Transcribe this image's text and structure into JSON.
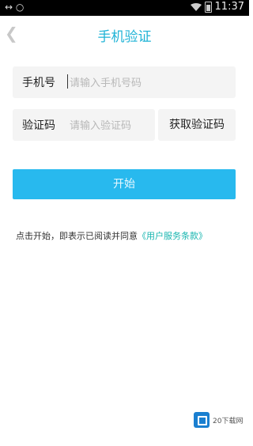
{
  "status_bar": {
    "left_icons": "↔ ○",
    "time": "11:37"
  },
  "header": {
    "back_icon": "chevron-left-icon",
    "title": "手机验证"
  },
  "form": {
    "phone_label": "手机号",
    "phone_placeholder": "请输入手机号码",
    "code_label": "验证码",
    "code_placeholder": "请输入验证码",
    "get_code_label": "获取验证码",
    "start_label": "开始"
  },
  "agreement": {
    "prefix": "点击开始，即表示已阅读并同意",
    "link": "《用户服务条款》"
  },
  "watermark": {
    "text": "20下载网"
  },
  "colors": {
    "accent": "#28b9ee",
    "title": "#1fb3d6",
    "link": "#19b6b0"
  }
}
